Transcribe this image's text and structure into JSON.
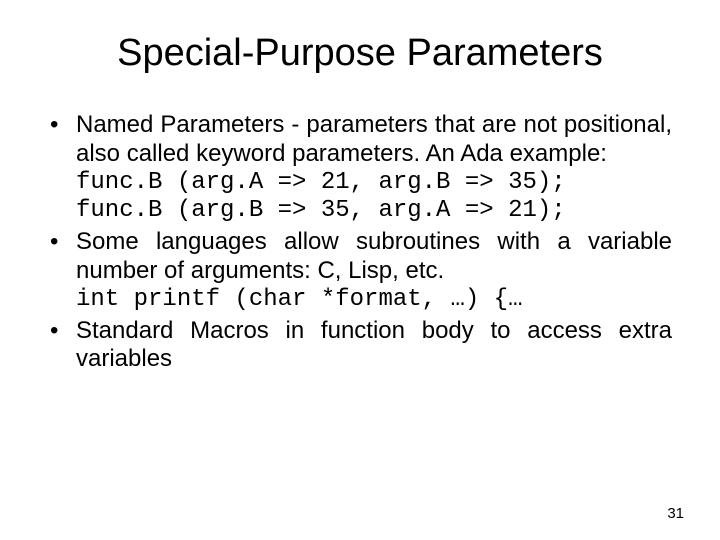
{
  "title": "Special-Purpose Parameters",
  "bullets": [
    {
      "text": "Named Parameters - parameters that are not positional, also called keyword parameters.  An Ada example:",
      "code": "func.B (arg.A => 21, arg.B => 35);\nfunc.B (arg.B => 35, arg.A => 21);"
    },
    {
      "text": "Some languages allow subroutines with a variable number of arguments: C, Lisp, etc.",
      "code": "int printf (char *format, …) {…"
    },
    {
      "text": "Standard Macros in function body to access extra variables"
    }
  ],
  "page_number": "31"
}
